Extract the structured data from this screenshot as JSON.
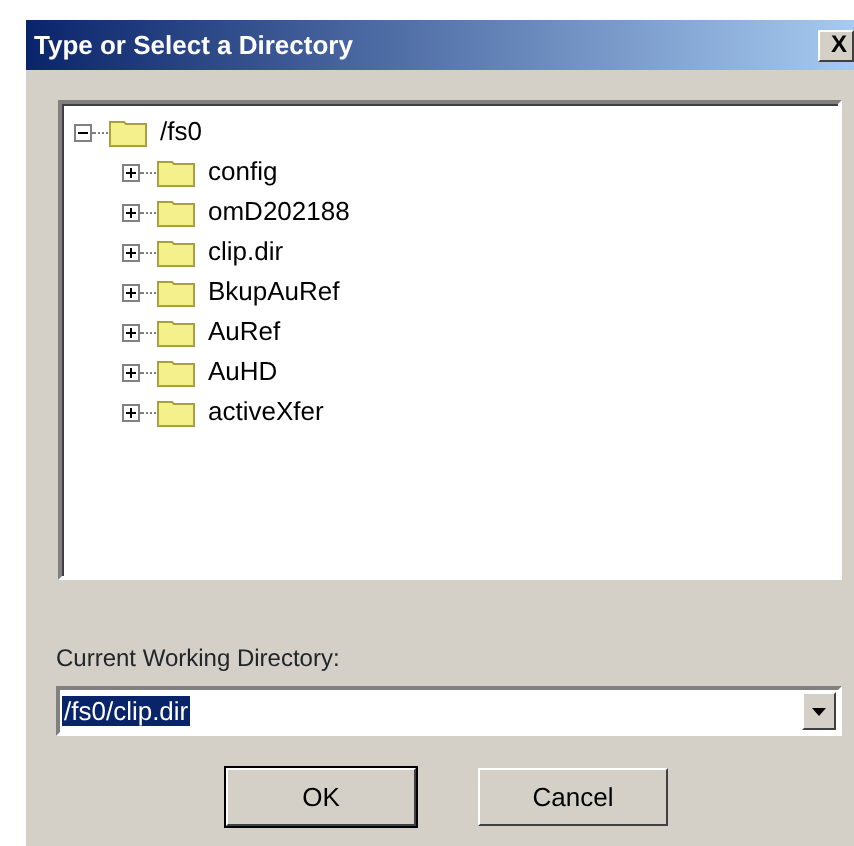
{
  "window": {
    "title": "Type or Select a Directory",
    "close_glyph": "X"
  },
  "tree": [
    {
      "label": "/fs0",
      "expanded": true,
      "children": [
        {
          "label": "config",
          "expanded": false
        },
        {
          "label": "omD202188",
          "expanded": false
        },
        {
          "label": "clip.dir",
          "expanded": false
        },
        {
          "label": "BkupAuRef",
          "expanded": false
        },
        {
          "label": "AuRef",
          "expanded": false
        },
        {
          "label": "AuHD",
          "expanded": false
        },
        {
          "label": "activeXfer",
          "expanded": false
        }
      ]
    }
  ],
  "directory_label": "Current Working Directory:",
  "directory_field": {
    "value": "/fs0/clip.dir",
    "text_selected": true
  },
  "buttons": [
    {
      "label": "OK",
      "default": true
    },
    {
      "label": "Cancel",
      "default": false
    }
  ]
}
